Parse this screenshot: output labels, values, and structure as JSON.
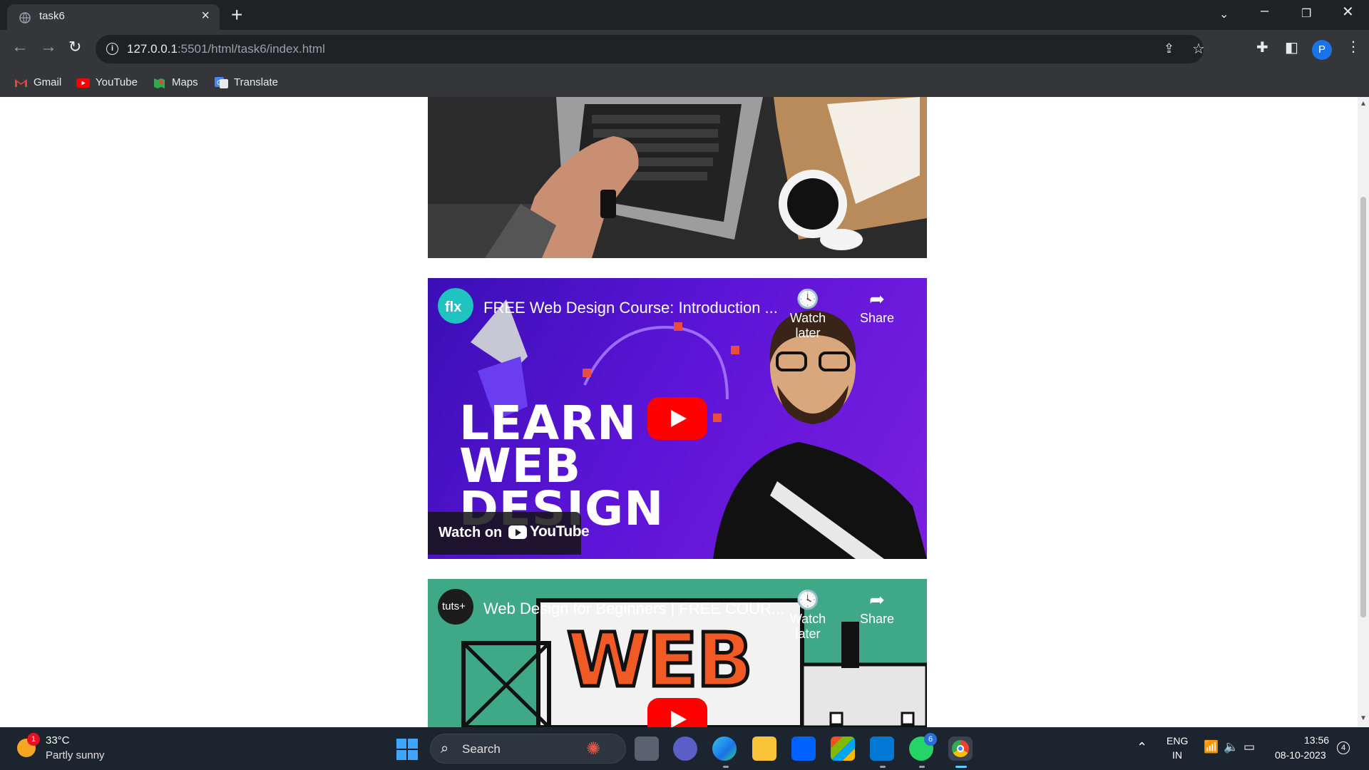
{
  "browser": {
    "tab_title": "task6",
    "new_tab_label": "+",
    "url_host": "127.0.0.1",
    "url_rest": ":5501/html/task6/index.html",
    "profile_initial": "P",
    "bookmarks": [
      {
        "label": "Gmail",
        "icon": "gmail-icon"
      },
      {
        "label": "YouTube",
        "icon": "youtube-icon"
      },
      {
        "label": "Maps",
        "icon": "maps-icon"
      },
      {
        "label": "Translate",
        "icon": "translate-icon"
      }
    ]
  },
  "page": {
    "image1": {
      "description_icon": "laptop-coffee-photo"
    },
    "video1": {
      "title": "FREE Web Design Course: Introduction ...",
      "watch_later": "Watch later",
      "share": "Share",
      "overlay_lines": [
        "LEARN",
        "WEB",
        "DESIGN"
      ],
      "watch_on": "Watch on",
      "youtube_word": "YouTube"
    },
    "video2": {
      "title": "Web Design for Beginners | FREE COUR...",
      "channel": "tuts+",
      "watch_later": "Watch later",
      "share": "Share",
      "overlay_word": "WEB"
    }
  },
  "taskbar": {
    "weather_temp": "33°C",
    "weather_cond": "Partly sunny",
    "weather_badge": "1",
    "search_label": "Search",
    "whatsapp_badge": "6",
    "lang_line1": "ENG",
    "lang_line2": "IN",
    "time": "13:56",
    "date": "08-10-2023",
    "notif_count": "4"
  },
  "colors": {
    "chrome_dark": "#202124",
    "chrome_toolbar": "#35363a",
    "youtube_red": "#ff0000",
    "video1_purple": "#5b14d6",
    "video2_teal": "#3fa886",
    "taskbar": "#1c2430"
  }
}
